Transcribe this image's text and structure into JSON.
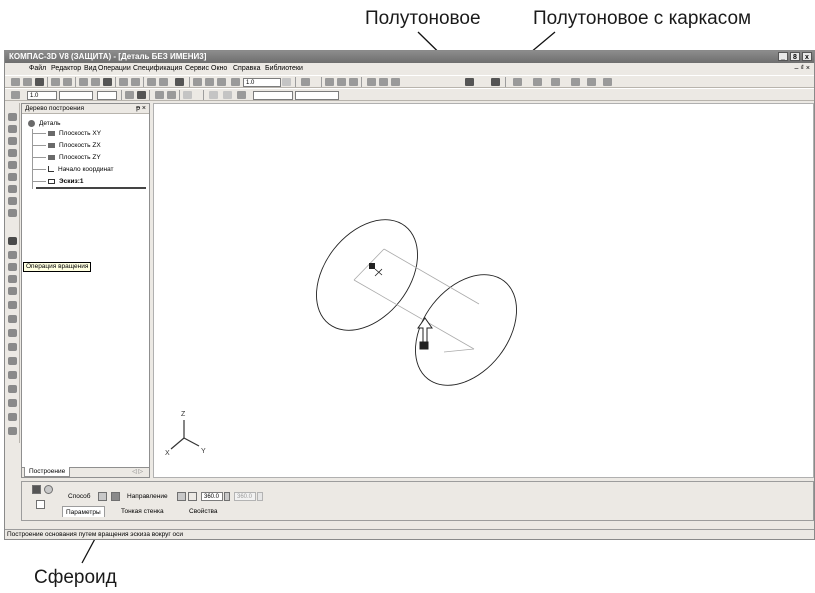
{
  "callouts": {
    "halftone": "Полутоновое",
    "halftone_wireframe": "Полутоновое с каркасом",
    "spheroid": "Сфероид"
  },
  "window": {
    "title": "КОМПАС-3D V8 (ЗАЩИТА) - [Деталь БЕЗ ИМЕНИ3]",
    "controls": [
      "_",
      "8",
      "x"
    ],
    "doc_controls": "– ₫ ×"
  },
  "menu": [
    "Файл",
    "Редактор",
    "Вид",
    "Операции",
    "Спецификация",
    "Сервис",
    "Окно",
    "Справка",
    "Библиотеки"
  ],
  "toolbar": {
    "zoom_value": "1.0",
    "scale_value": "1.0"
  },
  "tree": {
    "title": "Дерево построения",
    "title_controls": "ᵽ ×",
    "root": "Деталь",
    "items": [
      "Плоскость XY",
      "Плоскость ZX",
      "Плоскость ZY",
      "Начало координат",
      "Эскиз:1"
    ],
    "tab": "Построение",
    "tab_scroll": "◁ ▷"
  },
  "tooltip": "Операция вращения",
  "axes": {
    "x": "X",
    "y": "Y",
    "z": "Z"
  },
  "props": {
    "method_label": "Способ",
    "direction_label": "Направление",
    "angle1": "360.0",
    "angle2": "360.0",
    "tabs": [
      "Параметры",
      "Тонкая стенка",
      "Свойства"
    ]
  },
  "status": "Построение основания путем вращения эскиза вокруг оси"
}
